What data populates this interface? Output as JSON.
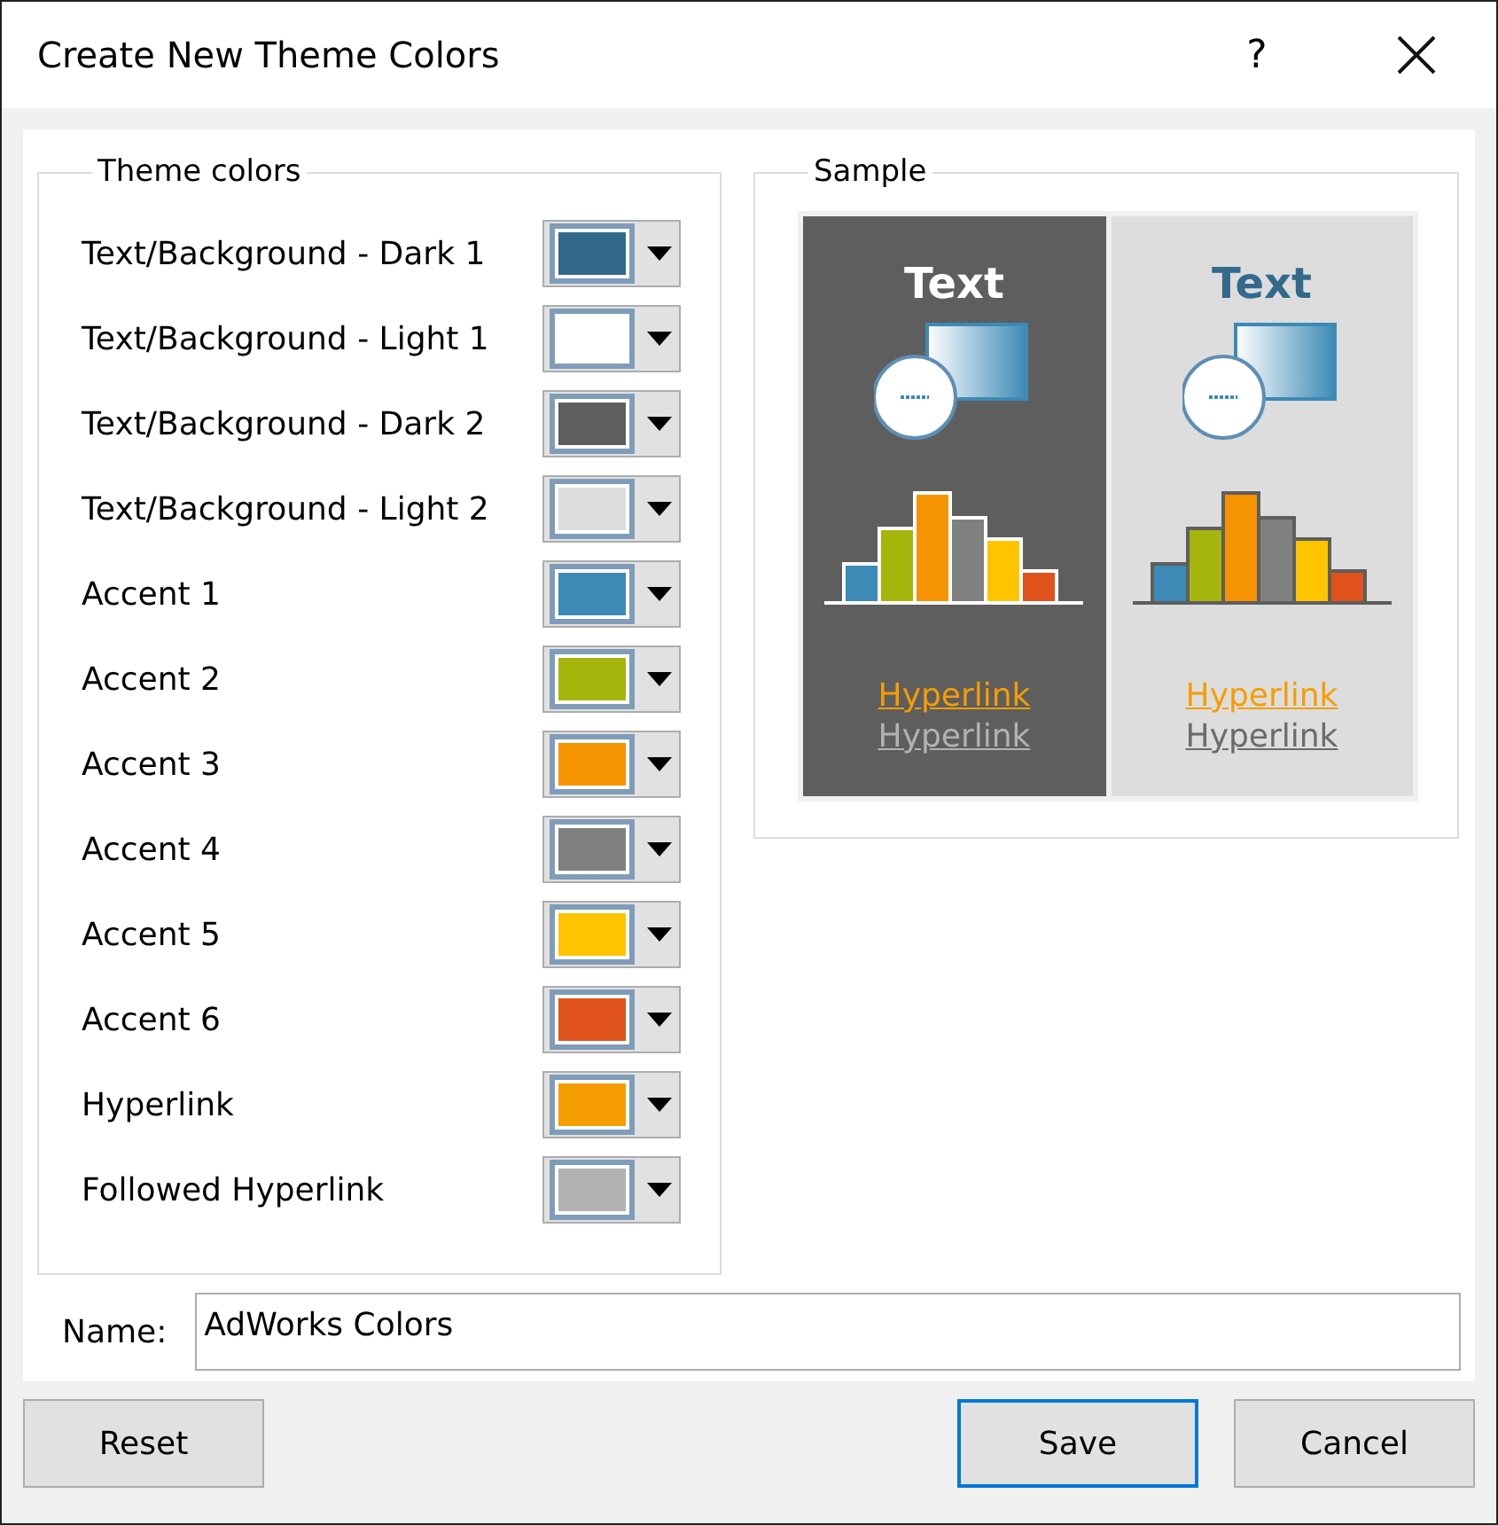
{
  "window": {
    "title": "Create New Theme Colors",
    "help": "?"
  },
  "theme_colors": {
    "title": "Theme colors",
    "rows": [
      {
        "label": "Text/Background - Dark 1",
        "color": "#336a8c"
      },
      {
        "label": "Text/Background - Light 1",
        "color": "#ffffff"
      },
      {
        "label": "Text/Background - Dark 2",
        "color": "#5e5e5e"
      },
      {
        "label": "Text/Background - Light 2",
        "color": "#dddddd"
      },
      {
        "label": "Accent 1",
        "color": "#3c8ab5"
      },
      {
        "label": "Accent 2",
        "color": "#a5b50c"
      },
      {
        "label": "Accent 3",
        "color": "#f59300"
      },
      {
        "label": "Accent 4",
        "color": "#808080"
      },
      {
        "label": "Accent 5",
        "color": "#fec400"
      },
      {
        "label": "Accent 6",
        "color": "#e0521b"
      },
      {
        "label": "Hyperlink",
        "color": "#f59d00"
      },
      {
        "label": "Followed Hyperlink",
        "color": "#b2b2b2"
      }
    ]
  },
  "sample": {
    "title": "Sample",
    "panels": [
      {
        "kind": "dark",
        "heading": "Text",
        "hyperlink": "Hyperlink",
        "followed_hyperlink": "Hyperlink"
      },
      {
        "kind": "light",
        "heading": "Text",
        "hyperlink": "Hyperlink",
        "followed_hyperlink": "Hyperlink"
      }
    ]
  },
  "name_field": {
    "label": "Name:",
    "value": "AdWorks Colors"
  },
  "buttons": [
    {
      "label": "Reset",
      "kind": "plain"
    },
    {
      "label": "Save",
      "kind": "default"
    },
    {
      "label": "Cancel",
      "kind": "plain"
    }
  ]
}
